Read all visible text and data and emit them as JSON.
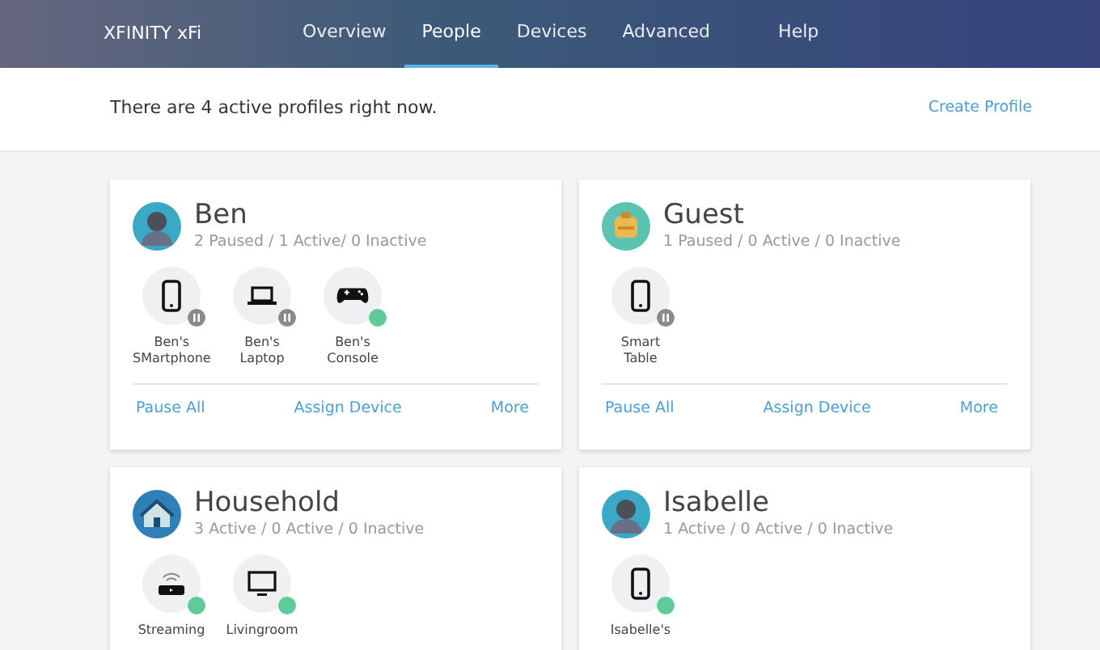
{
  "navbar": {
    "brand": "XFINITY xFi",
    "tabs": [
      {
        "label": "Overview",
        "selected": false
      },
      {
        "label": "People",
        "selected": true
      },
      {
        "label": "Devices",
        "selected": false
      },
      {
        "label": "Advanced",
        "selected": false
      },
      {
        "label": "Help",
        "selected": false
      }
    ]
  },
  "summary": {
    "text": "There are 4 active profiles right now.",
    "action": "Create Profile"
  },
  "profiles": [
    {
      "name": "Ben",
      "avatar": {
        "kind": "person"
      },
      "status": "2 Paused / 1 Active/ 0 Inactive",
      "devices": [
        {
          "kind": "phone",
          "label": "Ben's SMartphone",
          "paused": true
        },
        {
          "kind": "laptop",
          "label": "Ben's Laptop",
          "paused": true
        },
        {
          "kind": "console",
          "label": "Ben's Console",
          "paused": false
        }
      ],
      "actions": [
        "Pause All",
        "Assign Device",
        "More"
      ]
    },
    {
      "name": "Guest",
      "avatar": {
        "kind": "backpack"
      },
      "status": "1 Paused / 0 Active / 0 Inactive",
      "devices": [
        {
          "kind": "phone",
          "label": "Smart Table",
          "paused": true
        }
      ],
      "actions": [
        "Pause All",
        "Assign Device",
        "More"
      ]
    },
    {
      "name": "Household",
      "avatar": {
        "kind": "house"
      },
      "status": "3 Active / 0 Active / 0 Inactive",
      "devices": [
        {
          "kind": "streamer",
          "label": "Streaming",
          "paused": false
        },
        {
          "kind": "tv",
          "label": "Livingroom",
          "paused": false
        }
      ]
    },
    {
      "name": "Isabelle",
      "avatar": {
        "kind": "person"
      },
      "status": "1 Active / 0 Active / 0 Inactive",
      "devices": [
        {
          "kind": "phone",
          "label": "Isabelle's",
          "paused": false
        }
      ]
    }
  ]
}
